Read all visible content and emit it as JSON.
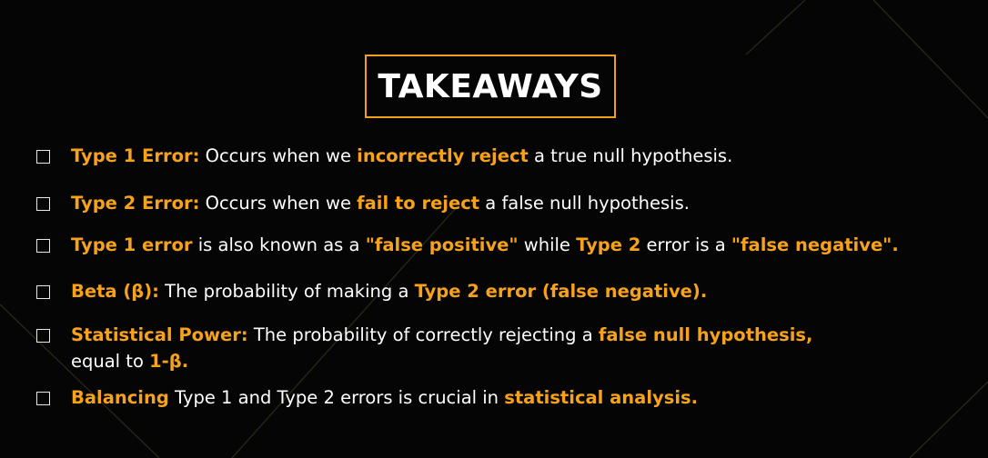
{
  "title": "TAKEAWAYS",
  "colors": {
    "accent": "#f7a21b",
    "background": "#050505",
    "text": "#ffffff"
  },
  "items": [
    {
      "checked": false,
      "segments": [
        {
          "text": "Type 1 Error:",
          "hl": true
        },
        {
          "text": " Occurs when we ",
          "hl": false
        },
        {
          "text": "incorrectly reject",
          "hl": true
        },
        {
          "text": " a true null hypothesis.",
          "hl": false
        }
      ]
    },
    {
      "checked": false,
      "segments": [
        {
          "text": "Type 2 Error:",
          "hl": true
        },
        {
          "text": " Occurs when we ",
          "hl": false
        },
        {
          "text": "fail to reject",
          "hl": true
        },
        {
          "text": " a false null hypothesis.",
          "hl": false
        }
      ]
    },
    {
      "checked": false,
      "segments": [
        {
          "text": "Type 1 error",
          "hl": true
        },
        {
          "text": " is also known as a ",
          "hl": false
        },
        {
          "text": "\"false positive\"",
          "hl": true
        },
        {
          "text": " while ",
          "hl": false
        },
        {
          "text": "Type 2",
          "hl": true
        },
        {
          "text": " error is a ",
          "hl": false
        },
        {
          "text": "\"false negative\".",
          "hl": true
        }
      ]
    },
    {
      "checked": false,
      "segments": [
        {
          "text": "Beta (β):",
          "hl": true
        },
        {
          "text": " The probability of making a ",
          "hl": false
        },
        {
          "text": "Type 2 error (false negative).",
          "hl": true
        }
      ]
    },
    {
      "checked": false,
      "segments": [
        {
          "text": "Statistical Power:",
          "hl": true
        },
        {
          "text": " The probability of correctly rejecting a ",
          "hl": false
        },
        {
          "text": "false null hypothesis,",
          "hl": true
        }
      ],
      "continuation": [
        {
          "text": "equal to ",
          "hl": false
        },
        {
          "text": "1-β.",
          "hl": true
        }
      ]
    },
    {
      "checked": false,
      "segments": [
        {
          "text": "Balancing",
          "hl": true
        },
        {
          "text": " Type 1 and Type 2 errors is crucial in ",
          "hl": false
        },
        {
          "text": "statistical analysis.",
          "hl": true
        }
      ]
    }
  ]
}
